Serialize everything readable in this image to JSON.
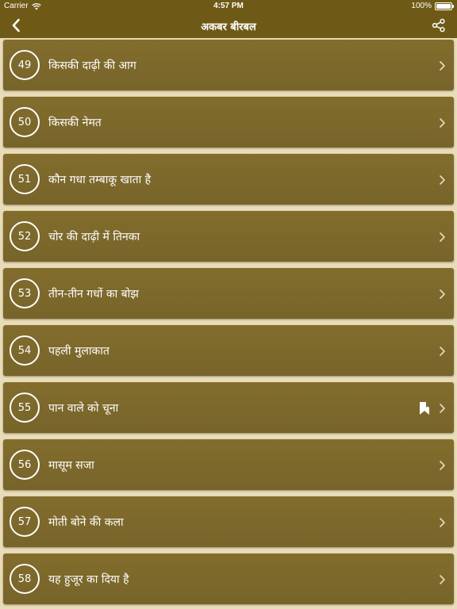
{
  "status_bar": {
    "carrier": "Carrier",
    "time": "4:57 PM",
    "battery": "100%",
    "battery_level": 1.0
  },
  "nav": {
    "title": "अकबर बीरबल",
    "back_icon": "chevron-left-icon",
    "share_icon": "share-icon"
  },
  "colors": {
    "bar": "#6e5a16",
    "row": "#7d6928",
    "background": "#e9dcb9",
    "text": "#ffffff"
  },
  "items": [
    {
      "number": "49",
      "title": "किसकी दाढ़ी की आग",
      "bookmarked": false
    },
    {
      "number": "50",
      "title": "किसकी नेमत",
      "bookmarked": false
    },
    {
      "number": "51",
      "title": "कौन गधा तम्बाकू खाता है",
      "bookmarked": false
    },
    {
      "number": "52",
      "title": "चोर की दाढ़ी में तिनका",
      "bookmarked": false
    },
    {
      "number": "53",
      "title": "तीन-तीन गधों का बोझ",
      "bookmarked": false
    },
    {
      "number": "54",
      "title": "पहली मुलाकात",
      "bookmarked": false
    },
    {
      "number": "55",
      "title": "पान वाले को चूना",
      "bookmarked": true
    },
    {
      "number": "56",
      "title": "मासूम सजा",
      "bookmarked": false
    },
    {
      "number": "57",
      "title": "मोती बोने की कला",
      "bookmarked": false
    },
    {
      "number": "58",
      "title": "यह हुजूर का दिया है",
      "bookmarked": false
    }
  ]
}
